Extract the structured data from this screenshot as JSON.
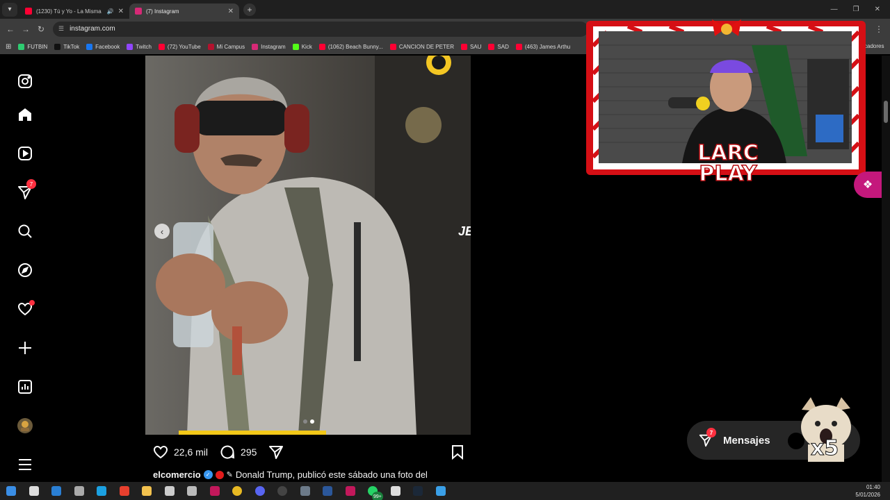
{
  "browser": {
    "tabs": [
      {
        "title": "(1230) Tú y Yo - La Misma C",
        "favicon_color": "#ff0033"
      },
      {
        "title": "(7) Instagram",
        "favicon_color": "#d62976"
      }
    ],
    "url": "instagram.com",
    "bookmarks": [
      {
        "label": "FUTBIN",
        "color": "#2ecc71"
      },
      {
        "label": "TikTok",
        "color": "#111111"
      },
      {
        "label": "Facebook",
        "color": "#1877f2"
      },
      {
        "label": "Twitch",
        "color": "#9146ff"
      },
      {
        "label": "(72) YouTube",
        "color": "#ff0033"
      },
      {
        "label": "Mi Campus",
        "color": "#b3122e"
      },
      {
        "label": "Instagram",
        "color": "#d62976"
      },
      {
        "label": "Kick",
        "color": "#53fc18"
      },
      {
        "label": "(1062) Beach Bunny...",
        "color": "#ff0033"
      },
      {
        "label": "CANCION DE PETER",
        "color": "#ff0033"
      },
      {
        "label": "SAU",
        "color": "#ff0033"
      },
      {
        "label": "SAD",
        "color": "#ff0033"
      },
      {
        "label": "(463) James Arthu",
        "color": "#ff0033"
      }
    ],
    "bookmarks_trailing": "cadores"
  },
  "sidebar": {
    "items": [
      {
        "name": "instagram-logo-icon"
      },
      {
        "name": "home-icon"
      },
      {
        "name": "reels-icon"
      },
      {
        "name": "messages-icon",
        "badge": "7"
      },
      {
        "name": "search-icon"
      },
      {
        "name": "explore-icon"
      },
      {
        "name": "notifications-icon",
        "dot": true
      },
      {
        "name": "create-icon"
      },
      {
        "name": "dashboard-icon"
      },
      {
        "name": "profile-avatar"
      },
      {
        "name": "menu-icon"
      }
    ]
  },
  "post": {
    "likes": "22,6 mil",
    "comments": "295",
    "username": "elcomercio",
    "caption": "Donald Trump, publicó este sábado una foto del",
    "image_overlay_text": "JEA"
  },
  "stream": {
    "logo_line1": "LARC",
    "logo_line2": "PLAY"
  },
  "messages_bar": {
    "label": "Mensajes",
    "badge": "7",
    "multiplier": "x5"
  },
  "taskbar": {
    "time": "01:40",
    "date": "5/01/2026",
    "icons": [
      {
        "name": "start-icon",
        "color": "#3a8ee6"
      },
      {
        "name": "search-taskbar-icon",
        "color": "#dddddd"
      },
      {
        "name": "store-icon",
        "color": "#2a7fd4"
      },
      {
        "name": "app-cat-icon",
        "color": "#aaaaaa"
      },
      {
        "name": "edge-icon",
        "color": "#1ba1e2"
      },
      {
        "name": "app-red-icon",
        "color": "#e8402e"
      },
      {
        "name": "explorer-icon",
        "color": "#f2c14e"
      },
      {
        "name": "app-g-icon",
        "color": "#cccccc"
      },
      {
        "name": "app-bot-icon",
        "color": "#bbbbbb"
      },
      {
        "name": "app-pink-icon",
        "color": "#c2185b"
      },
      {
        "name": "chrome-icon",
        "color": "#e8b923"
      },
      {
        "name": "discord-icon",
        "color": "#5865f2"
      },
      {
        "name": "obs-icon",
        "color": "#444444"
      },
      {
        "name": "calculator-icon",
        "color": "#6c7a89"
      },
      {
        "name": "word-icon",
        "color": "#2b579a"
      },
      {
        "name": "app-pink2-icon",
        "color": "#c2185b"
      },
      {
        "name": "whatsapp-icon",
        "color": "#25d366"
      },
      {
        "name": "app-box-icon",
        "color": "#dddddd"
      },
      {
        "name": "steam-icon",
        "color": "#1b2838"
      },
      {
        "name": "app-blue-icon",
        "color": "#3aa0e8"
      }
    ],
    "notification_badge": "99+"
  }
}
